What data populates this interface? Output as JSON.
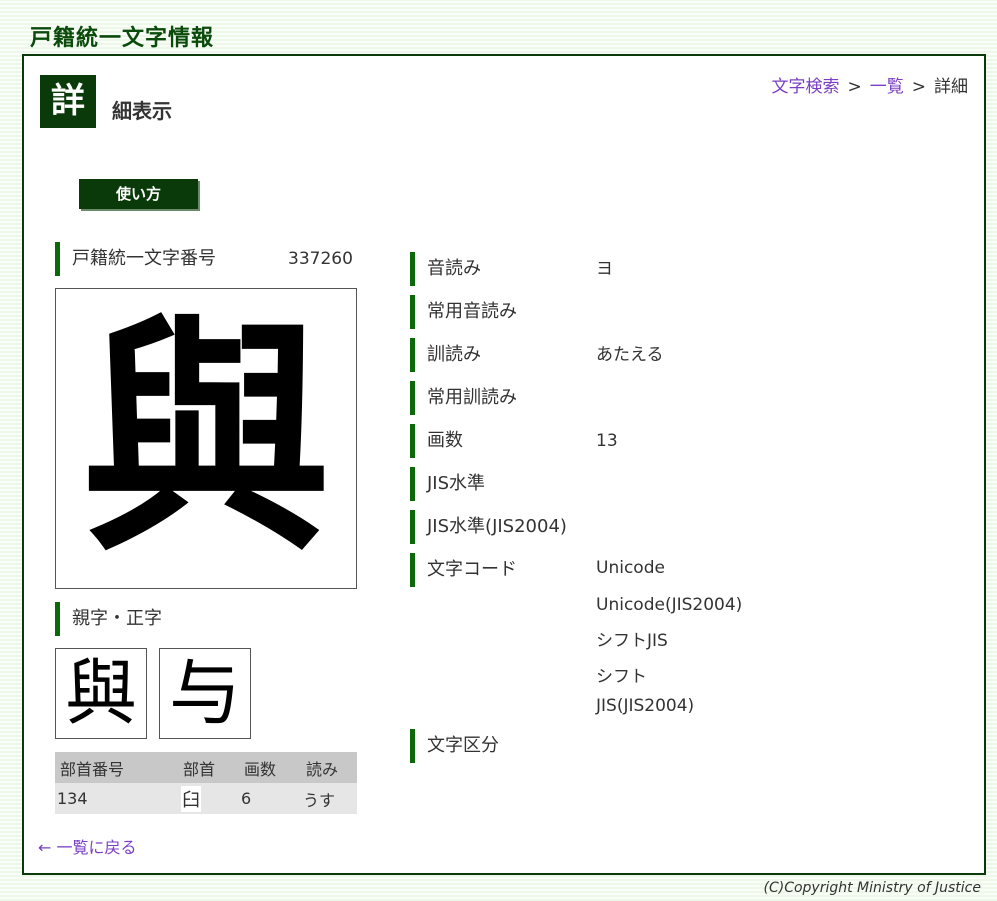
{
  "header": {
    "site_title": "戸籍統一文字情報"
  },
  "page": {
    "badge": "詳",
    "title": "細表示"
  },
  "breadcrumb": {
    "search": "文字検索",
    "list": "一覧",
    "current": "詳細",
    "separator": ">"
  },
  "usage_button": "使い方",
  "character": {
    "number_label": "戸籍統一文字番号",
    "number": "337260",
    "glyph": "與"
  },
  "parent_chars": {
    "label": "親字・正字",
    "glyphs": [
      "與",
      "与"
    ]
  },
  "radical_table": {
    "headers": [
      "部首番号",
      "部首",
      "画数",
      "読み"
    ],
    "row": [
      "134",
      "臼",
      "6",
      "うす"
    ]
  },
  "properties": [
    {
      "label": "音読み",
      "values": [
        "ヨ"
      ]
    },
    {
      "label": "常用音読み",
      "values": []
    },
    {
      "label": "訓読み",
      "values": [
        "あたえる"
      ]
    },
    {
      "label": "常用訓読み",
      "values": []
    },
    {
      "label": "画数",
      "values": [
        "13"
      ]
    },
    {
      "label": "JIS水準",
      "values": []
    },
    {
      "label": "JIS水準(JIS2004)",
      "values": []
    },
    {
      "label": "文字コード",
      "values": [
        "Unicode",
        "Unicode(JIS2004)",
        "シフトJIS",
        "シフト",
        "JIS(JIS2004)"
      ]
    },
    {
      "label": "文字区分",
      "values": []
    }
  ],
  "back_link": "← 一覧に戻る",
  "footer": {
    "copyright": "(C)Copyright Ministry of Justice"
  },
  "colors": {
    "accent": "#0a3a0a",
    "bar": "#0a6a0a",
    "link": "#7a3fc2"
  }
}
